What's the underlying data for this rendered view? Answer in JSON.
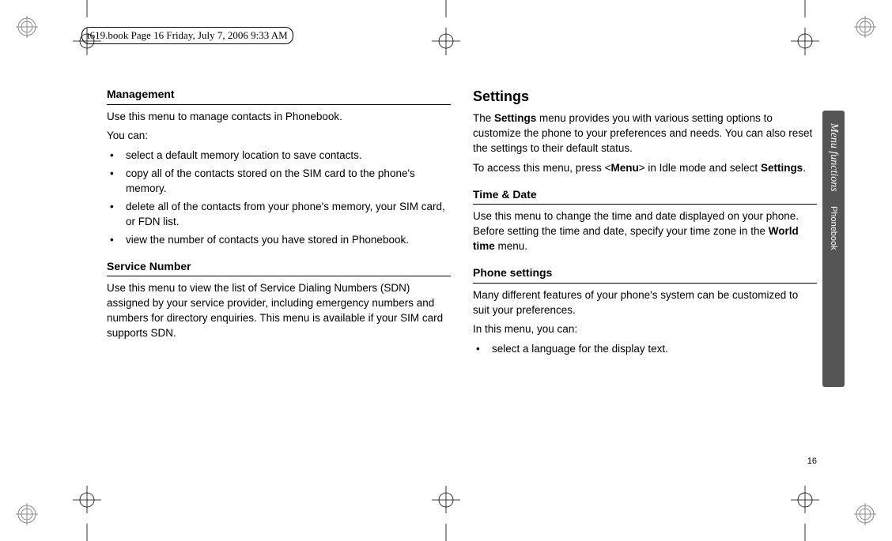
{
  "header": {
    "info": "t619.book  Page 16  Friday, July 7, 2006  9:33 AM"
  },
  "left_column": {
    "heading1": "Management",
    "p1": "Use this menu to manage contacts in Phonebook.",
    "p2": "You can:",
    "bullets": [
      "select a default memory location to save contacts.",
      "copy all of the contacts stored on the SIM card to the phone's memory.",
      "delete all of the contacts from your phone's memory, your SIM card, or FDN list.",
      "view the number of contacts you have stored in Phonebook."
    ],
    "heading2": "Service Number",
    "p3": "Use this menu to view the list of Service Dialing Numbers (SDN) assigned by your service provider, including emergency numbers and numbers for directory enquiries. This menu is available if your SIM card supports SDN."
  },
  "right_column": {
    "main_heading": "Settings",
    "p1_pre": "The ",
    "p1_bold1": "Settings",
    "p1_post": " menu provides you with various setting options to customize the phone to your preferences and needs. You can also reset the settings to their default status.",
    "p2_pre": "To access this menu, press <",
    "p2_bold1": "Menu",
    "p2_mid": "> in Idle mode and select ",
    "p2_bold2": "Settings",
    "p2_post": ".",
    "heading2": "Time & Date",
    "p3_pre": "Use this menu to change the time and date displayed on your phone. Before setting the time and date, specify your time zone in the ",
    "p3_bold1": "World time",
    "p3_post": " menu.",
    "heading3": "Phone settings",
    "p4": "Many different features of your phone's system can be customized to suit your preferences.",
    "p5": "In this menu, you can:",
    "bullets": [
      "select a language for the display text."
    ]
  },
  "side_tab": {
    "primary": "Menu functions",
    "secondary": "Phonebook"
  },
  "page_number": "16"
}
